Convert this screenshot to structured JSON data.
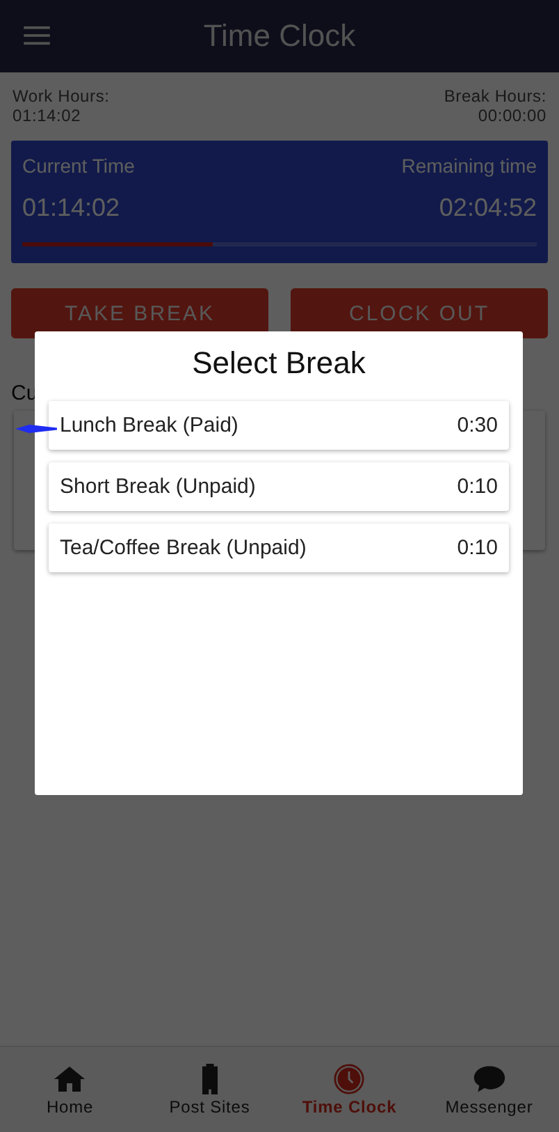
{
  "header": {
    "title": "Time Clock"
  },
  "summary": {
    "work_label": "Work Hours:",
    "work_value": "01:14:02",
    "break_label": "Break Hours:",
    "break_value": "00:00:00"
  },
  "timer_card": {
    "current_label": "Current Time",
    "current_value": "01:14:02",
    "remaining_label": "Remaining time",
    "remaining_value": "02:04:52",
    "level": 0.37
  },
  "buttons": [
    "TAKE BREAK",
    "CLOCK OUT"
  ],
  "section_heading": "Cu",
  "dialog": {
    "title": "Select Break",
    "items": [
      {
        "name": "Lunch Break (Paid)",
        "duration": "0:30",
        "pointed": true
      },
      {
        "name": "Short Break (Unpaid)",
        "duration": "0:10",
        "pointed": false
      },
      {
        "name": "Tea/Coffee Break (Unpaid)",
        "duration": "0:10",
        "pointed": false
      }
    ]
  },
  "bottom_nav": [
    {
      "label": "Home",
      "kind": "home",
      "selected": false
    },
    {
      "label": "Post Sites",
      "kind": "building",
      "selected": false
    },
    {
      "label": "Time Clock",
      "kind": "clock",
      "selected": true
    },
    {
      "label": "Messenger",
      "kind": "chat",
      "selected": false
    }
  ]
}
